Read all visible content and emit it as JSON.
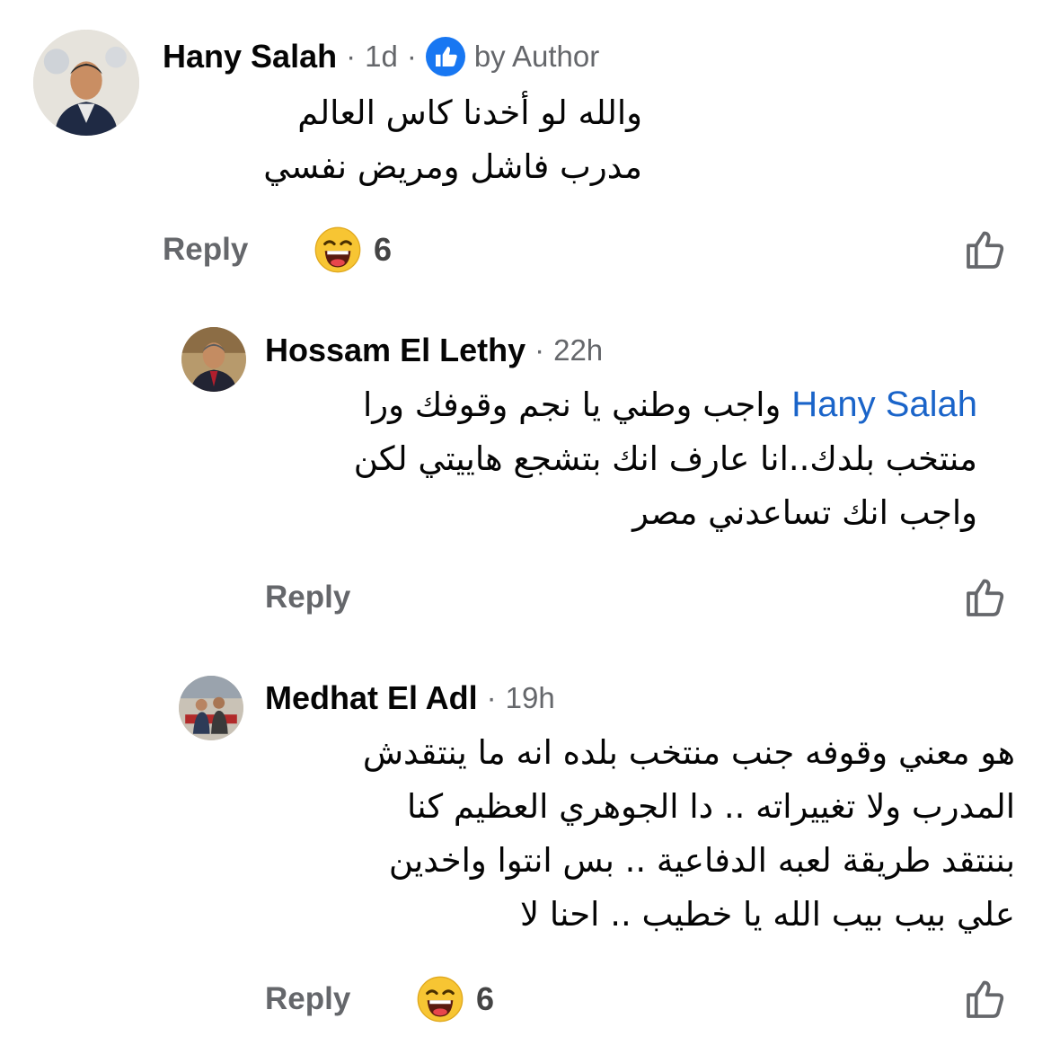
{
  "comments": [
    {
      "author": "Hany Salah",
      "time": "1d",
      "author_badge": "by Author",
      "lines": [
        "والله لو أخدنا كاس العالم",
        "مدرب فاشل ومريض نفسي"
      ],
      "reply_label": "Reply",
      "reaction_icon": "laughing-emoji-icon",
      "reaction_count": "6"
    },
    {
      "author": "Hossam El Lethy",
      "time": "22h",
      "mention": "Hany Salah",
      "first_line_text": "واجب وطني يا نجم وقوفك ورا",
      "lines": [
        "منتخب بلدك..انا عارف انك بتشجع هاييتي لكن",
        "واجب انك تساعدني مصر"
      ],
      "reply_label": "Reply"
    },
    {
      "author": "Medhat El Adl",
      "time": "19h",
      "lines": [
        "هو معني وقوفه جنب منتخب بلده انه ما ينتقدش",
        "المدرب ولا تغييراته .. دا الجوهري العظيم كنا",
        "بننتقد طريقة لعبه الدفاعية .. بس انتوا واخدين",
        "علي بيب بيب الله يا خطيب .. احنا لا"
      ],
      "reply_label": "Reply",
      "reaction_icon": "laughing-emoji-icon",
      "reaction_count": "6"
    }
  ],
  "colors": {
    "secondary_text": "#65676b",
    "link": "#1a64c9",
    "badge_blue": "#1877f2"
  },
  "separator": "·"
}
